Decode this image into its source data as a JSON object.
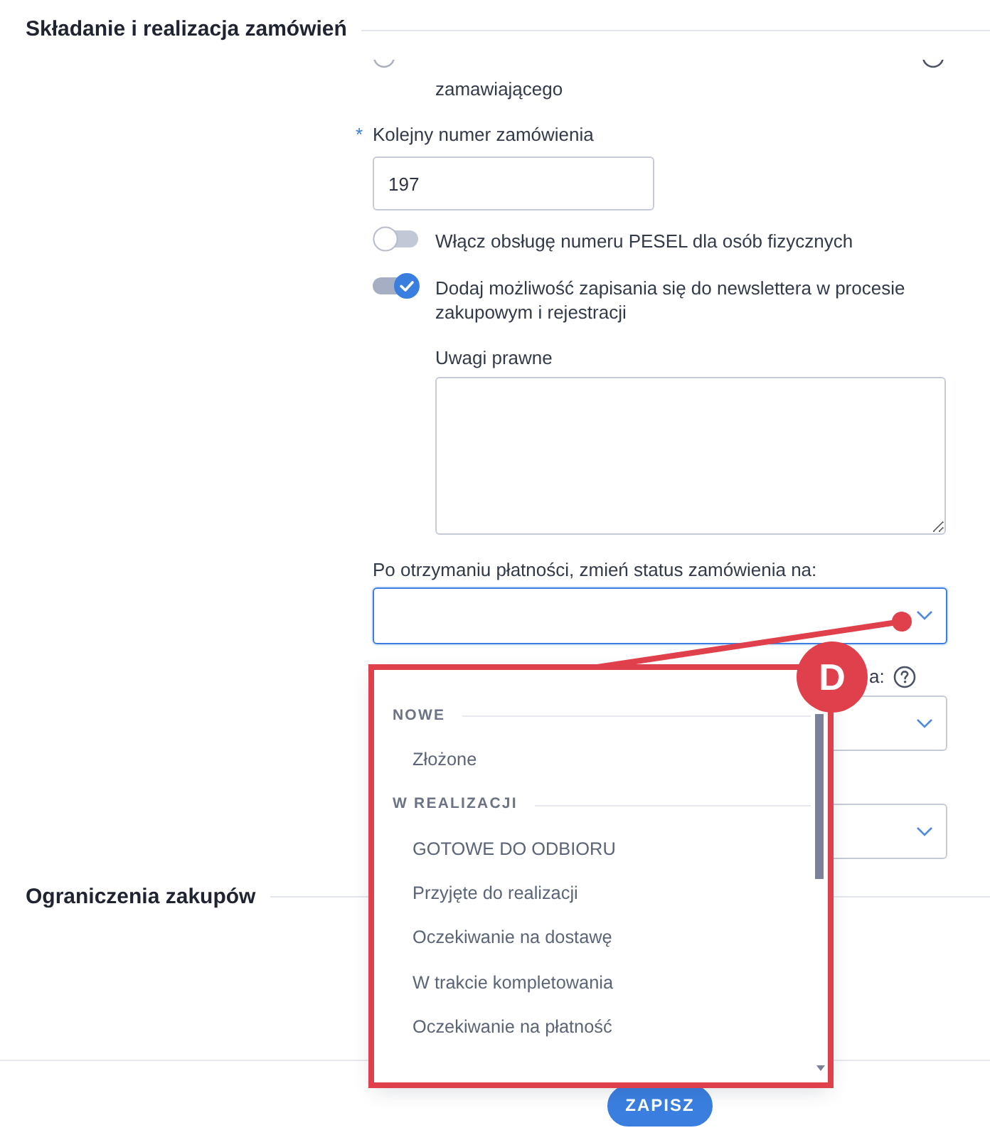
{
  "sections": [
    {
      "title": "Składanie i realizacja zamówień"
    },
    {
      "title": "Ograniczenia zakupów"
    }
  ],
  "radio_option": {
    "label": "zamawiającego",
    "selected": false
  },
  "order_number": {
    "required_mark": "*",
    "label": "Kolejny numer zamówienia",
    "value": "197"
  },
  "toggles": [
    {
      "label": "Włącz obsługę numeru PESEL dla osób fizycznych",
      "on": false
    },
    {
      "label": "Dodaj możliwość zapisania się do newslettera w procesie zakupowym i rejestracji",
      "on": true
    }
  ],
  "legal_notes": {
    "label": "Uwagi prawne"
  },
  "status_select": {
    "label": "Po otrzymaniu płatności, zmień status zamówienia na:",
    "expanded": true
  },
  "next_field": {
    "label": "a:"
  },
  "status_menu": {
    "groups": [
      {
        "title": "NOWE",
        "options": [
          {
            "label": "Złożone",
            "selected": false
          }
        ]
      },
      {
        "title": "W REALIZACJI",
        "options": [
          {
            "label": "GOTOWE DO ODBIORU",
            "selected": false
          },
          {
            "label": "Przyjęte do realizacji",
            "selected": false
          },
          {
            "label": "Oczekiwanie na dostawę",
            "selected": false
          },
          {
            "label": "W trakcie kompletowania",
            "selected": false
          },
          {
            "label": "Oczekiwanie na płatność",
            "selected": false
          }
        ]
      }
    ]
  },
  "annotation": {
    "label": "D"
  },
  "footer": {
    "save_button": "ZAPISZ"
  }
}
